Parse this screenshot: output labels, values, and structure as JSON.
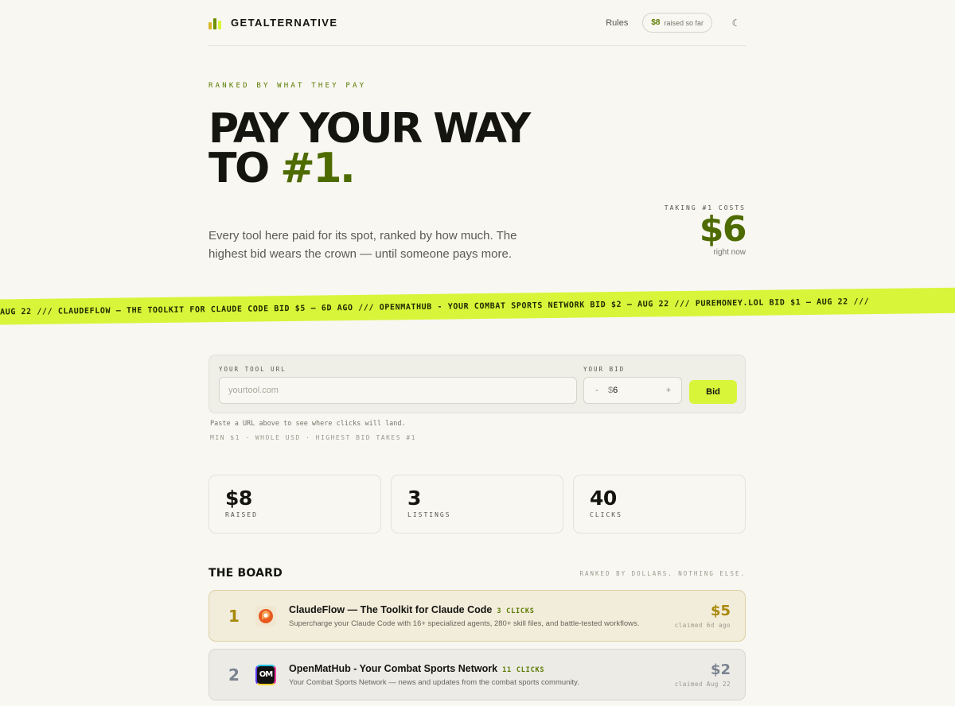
{
  "header": {
    "brand": "GETALTERNATIVE",
    "nav_rules": "Rules",
    "raised_amount": "$8",
    "raised_label": "raised so far",
    "theme_icon": "moon-icon"
  },
  "hero": {
    "eyebrow": "RANKED BY WHAT THEY PAY",
    "headline_line1": "PAY YOUR WAY",
    "headline_line2_prefix": "TO ",
    "headline_accent": "#1.",
    "lede": "Every tool here paid for its spot, ranked by how much. The highest bid wears the crown — until someone pays more.",
    "cost_label": "TAKING #1 COSTS",
    "cost_value": "$6",
    "cost_sub": "right now"
  },
  "ticker": {
    "text": "AUG 22 ///    CLAUDEFLOW — THE TOOLKIT FOR CLAUDE CODE BID $5 — 6D AGO /// OPENMATHUB - YOUR COMBAT SPORTS NETWORK BID $2 — AUG 22 /// PUREMONEY.LOL BID $1 — AUG 22 ///"
  },
  "bid_form": {
    "url_label": "YOUR TOOL URL",
    "url_placeholder": "yourtool.com",
    "url_value": "",
    "bid_label": "YOUR BID",
    "minus": "-",
    "currency": "$",
    "bid_value": "6",
    "plus": "+",
    "submit_label": "Bid",
    "hint": "Paste a URL above to see where clicks will land.",
    "rules": "MIN $1 · WHOLE USD · HIGHEST BID TAKES #1"
  },
  "stats": [
    {
      "value": "$8",
      "label": "RAISED"
    },
    {
      "value": "3",
      "label": "LISTINGS"
    },
    {
      "value": "40",
      "label": "CLICKS"
    }
  ],
  "board": {
    "title": "THE BOARD",
    "tagline": "RANKED BY DOLLARS. NOTHING ELSE.",
    "rows": [
      {
        "rank": "1",
        "icon": "claudeflow-logo-icon",
        "name": "ClaudeFlow — The Toolkit for Claude Code",
        "clicks": "3 CLICKS",
        "description": "Supercharge your Claude Code with 16+ specialized agents, 280+ skill files, and battle-tested workflows.",
        "price": "$5",
        "claimed": "claimed 6d ago",
        "color": "#a8890a"
      },
      {
        "rank": "2",
        "icon": "openmathub-logo-icon",
        "name": "OpenMatHub - Your Combat Sports Network",
        "clicks": "11 CLICKS",
        "description": "Your Combat Sports Network — news and updates from the combat sports community.",
        "price": "$2",
        "claimed": "claimed Aug 22",
        "avatar_text": "OM",
        "color": "#7b8390"
      }
    ]
  },
  "colors": {
    "background": "#f8f7f1",
    "accent_lime": "#d9f53a",
    "accent_green": "#4e6b00",
    "gold": "#a8890a"
  }
}
